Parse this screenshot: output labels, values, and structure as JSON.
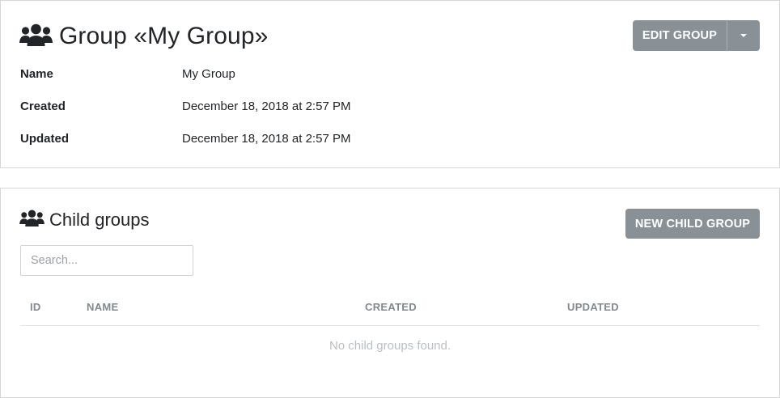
{
  "group": {
    "title": "Group «My Group»",
    "edit_button": "EDIT GROUP",
    "fields": [
      {
        "label": "Name",
        "value": "My Group"
      },
      {
        "label": "Created",
        "value": "December 18, 2018 at 2:57 PM"
      },
      {
        "label": "Updated",
        "value": "December 18, 2018 at 2:57 PM"
      }
    ]
  },
  "child_groups": {
    "title": "Child groups",
    "new_button": "NEW CHILD GROUP",
    "search_placeholder": "Search...",
    "columns": [
      "ID",
      "NAME",
      "CREATED",
      "UPDATED"
    ],
    "empty_message": "No child groups found."
  },
  "icons": {
    "title_icon": "users-icon"
  },
  "colors": {
    "button": "#8a9196",
    "text": "#212529",
    "muted": "#808a92",
    "empty": "#b9bfc4"
  }
}
